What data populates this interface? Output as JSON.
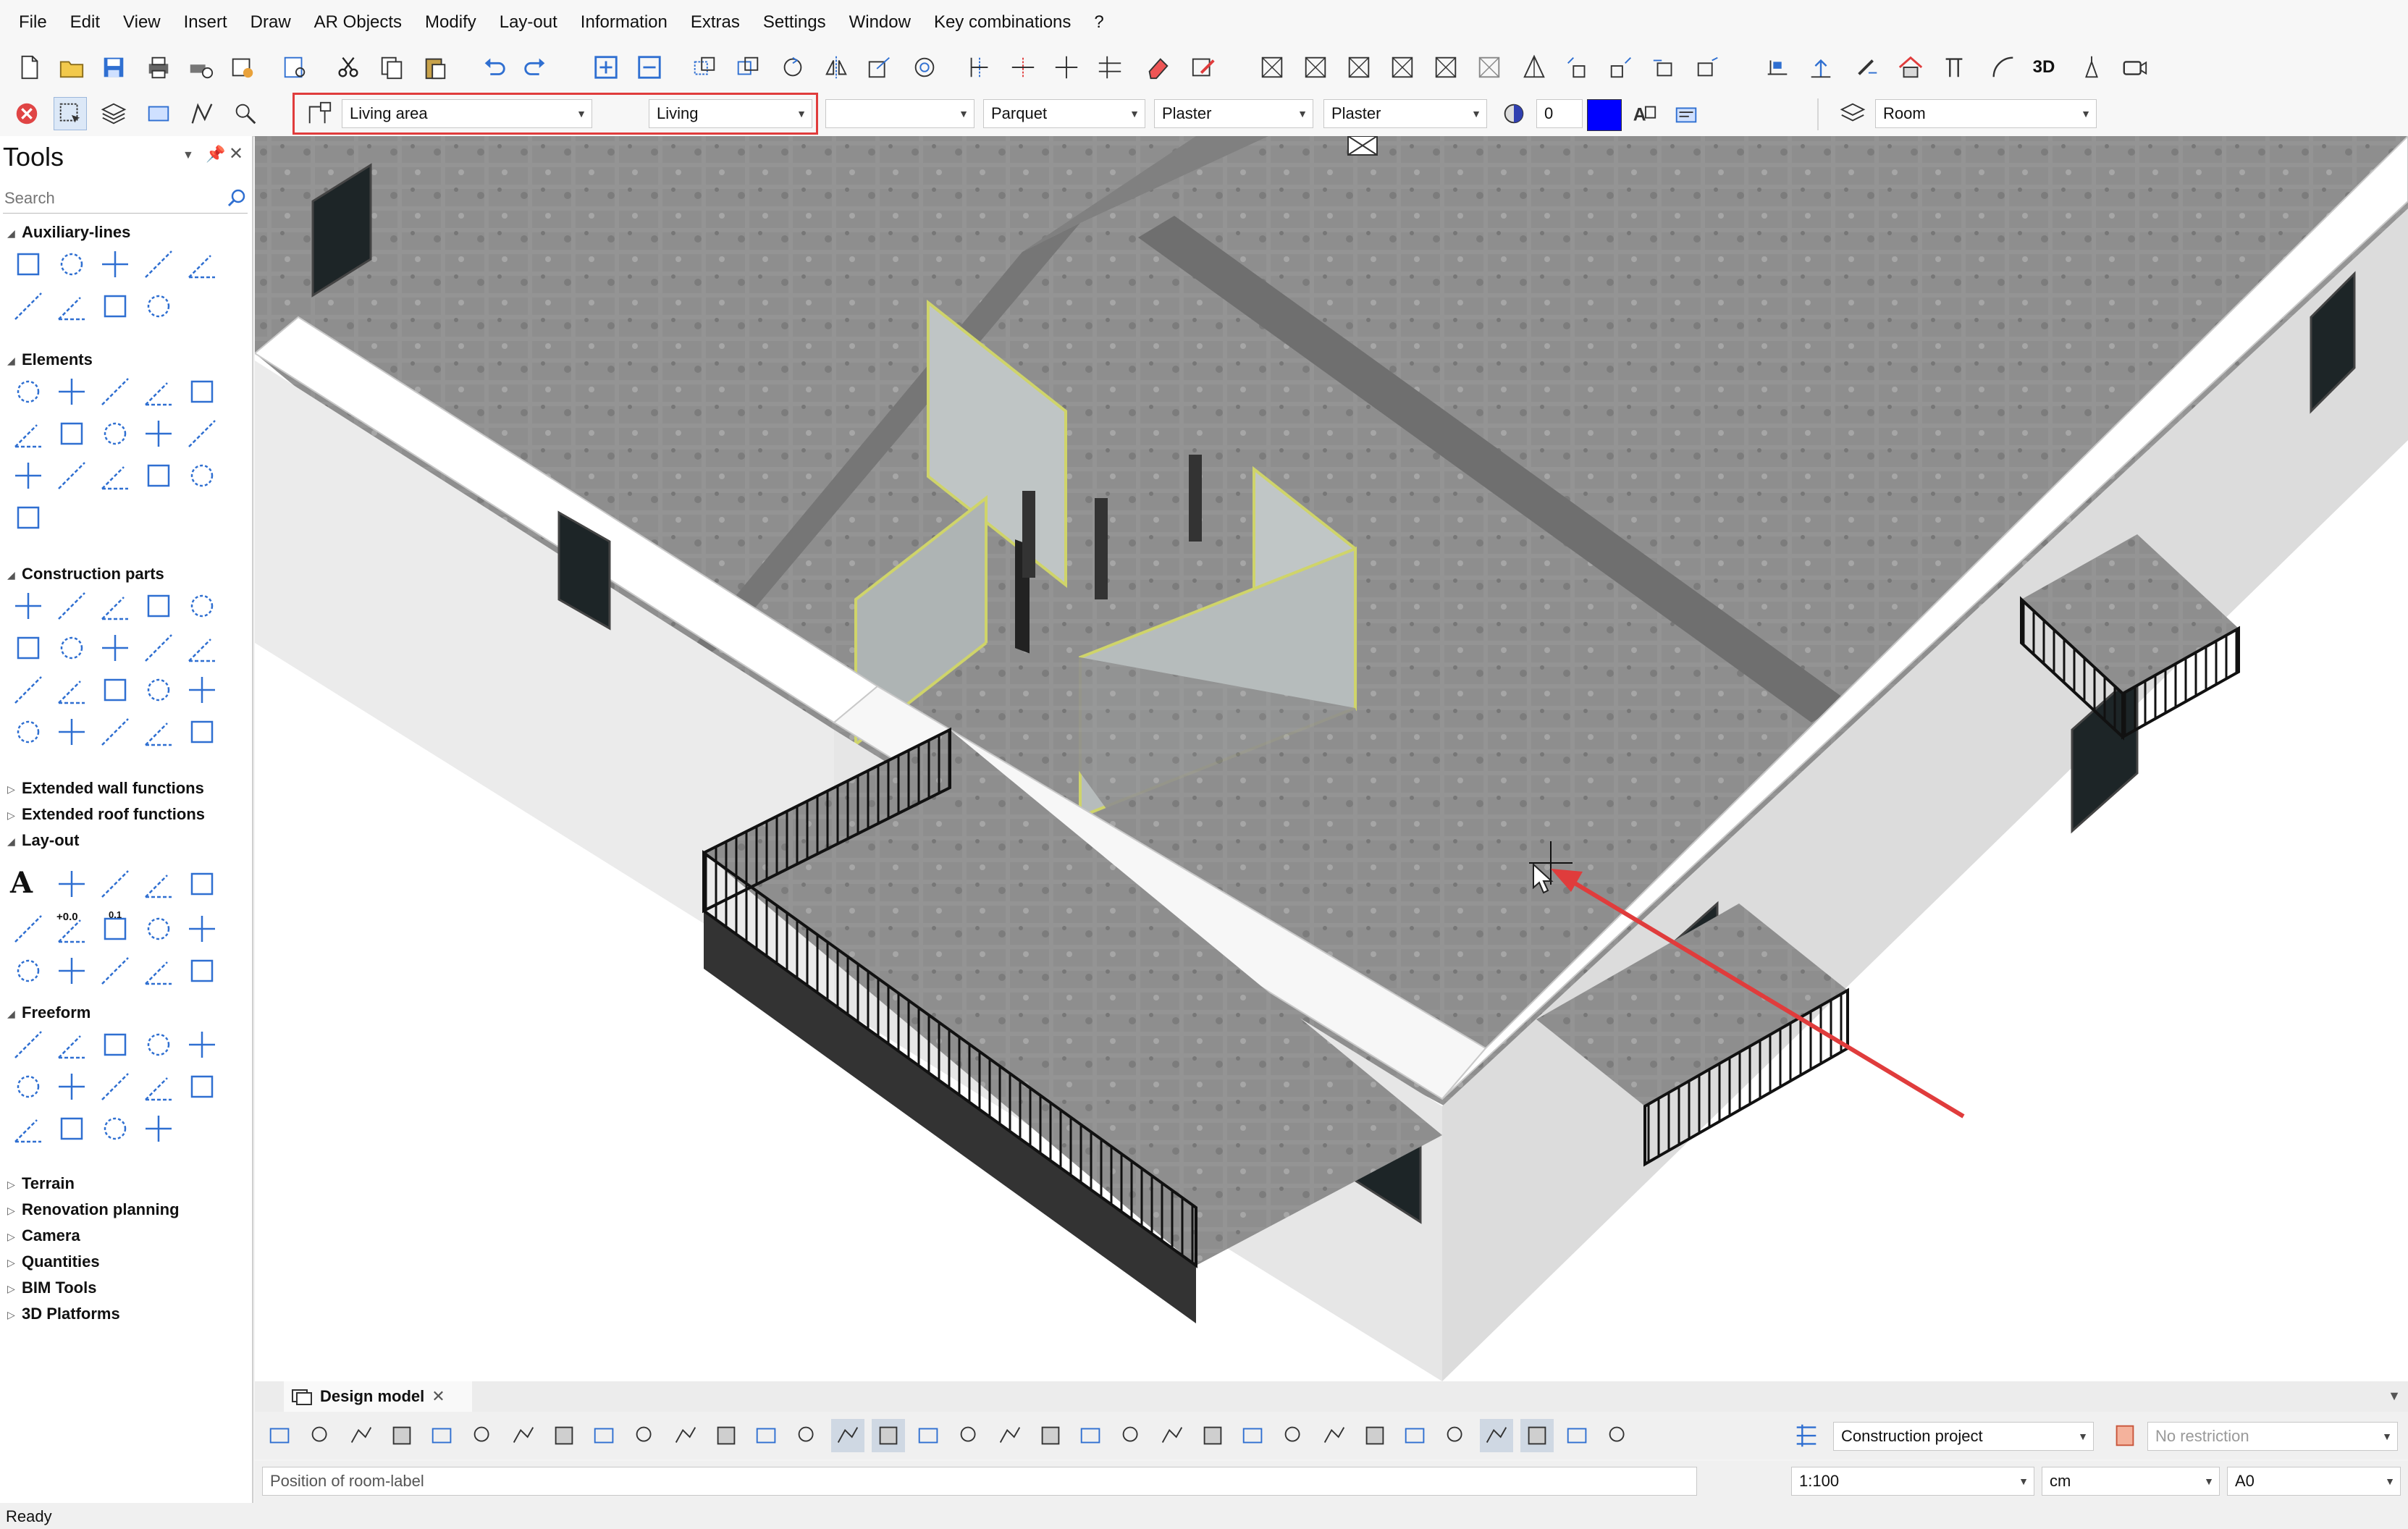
{
  "menu": [
    "File",
    "Edit",
    "View",
    "Insert",
    "Draw",
    "AR Objects",
    "Modify",
    "Lay-out",
    "Information",
    "Extras",
    "Settings",
    "Window",
    "Key combinations",
    "?"
  ],
  "properties_bar": {
    "room_function": "Living area",
    "room_name": "Living",
    "blank_field": "",
    "floor_finish": "Parquet",
    "wall_finish": "Plaster",
    "ceiling_finish": "Plaster",
    "color_value": "0",
    "color_swatch": "#0000ff",
    "layer": "Room"
  },
  "tools_panel": {
    "title": "Tools",
    "search_placeholder": "Search",
    "sections": {
      "auxiliary_lines": "Auxiliary-lines",
      "elements": "Elements",
      "construction_parts": "Construction parts",
      "extended_wall": "Extended wall functions",
      "extended_roof": "Extended roof functions",
      "layout": "Lay-out",
      "freeform": "Freeform",
      "terrain": "Terrain",
      "renovation": "Renovation planning",
      "camera": "Camera",
      "quantities": "Quantities",
      "bim_tools": "BIM Tools",
      "platforms_3d": "3D Platforms"
    },
    "layout_labels": {
      "text_a": "A",
      "level": "+0.0",
      "point_level": "0.1"
    }
  },
  "toolbar_labels": {
    "view_3d": "3D"
  },
  "document_tab": "Design model",
  "bottom": {
    "project": "Construction project",
    "restriction": "No restriction",
    "prompt": "Position of room-label",
    "scale": "1:100",
    "unit": "cm",
    "paper": "A0"
  },
  "status": "Ready",
  "colors": {
    "highlight": "#e03c3c",
    "arrow": "#e03c3c",
    "accent_blue": "#1f6fd1"
  }
}
